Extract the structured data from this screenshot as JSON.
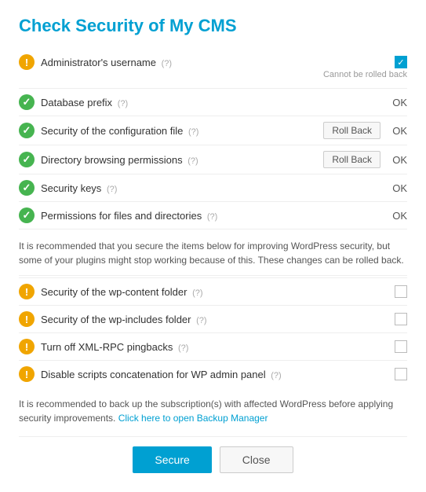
{
  "title": "Check Security of My CMS",
  "items_secure": [
    {
      "id": "admin-username",
      "label": "Administrator's username",
      "help": "(?)",
      "status": "",
      "has_checkbox": true,
      "checked": true,
      "cannot_rollback": "Cannot be rolled back",
      "icon": "warn",
      "has_rollback": false
    },
    {
      "id": "db-prefix",
      "label": "Database prefix",
      "help": "(?)",
      "status": "OK",
      "has_checkbox": false,
      "icon": "ok",
      "has_rollback": false
    },
    {
      "id": "config-file",
      "label": "Security of the configuration file",
      "help": "(?)",
      "status": "OK",
      "has_checkbox": false,
      "icon": "ok",
      "has_rollback": true,
      "rollback_label": "Roll Back"
    },
    {
      "id": "dir-browsing",
      "label": "Directory browsing permissions",
      "help": "(?)",
      "status": "OK",
      "has_checkbox": false,
      "icon": "ok",
      "has_rollback": true,
      "rollback_label": "Roll Back"
    },
    {
      "id": "security-keys",
      "label": "Security keys",
      "help": "(?)",
      "status": "OK",
      "has_checkbox": false,
      "icon": "ok",
      "has_rollback": false
    },
    {
      "id": "file-permissions",
      "label": "Permissions for files and directories",
      "help": "(?)",
      "status": "OK",
      "has_checkbox": false,
      "icon": "ok",
      "has_rollback": false
    }
  ],
  "info_text": "It is recommended that you secure the items below for improving WordPress security, but some of your plugins might stop working because of this. These changes can be rolled back.",
  "items_optional": [
    {
      "id": "wp-content",
      "label": "Security of the wp-content folder",
      "help": "(?)",
      "icon": "warn"
    },
    {
      "id": "wp-includes",
      "label": "Security of the wp-includes folder",
      "help": "(?)",
      "icon": "warn"
    },
    {
      "id": "xml-rpc",
      "label": "Turn off XML-RPC pingbacks",
      "help": "(?)",
      "icon": "warn"
    },
    {
      "id": "scripts-concat",
      "label": "Disable scripts concatenation for WP admin panel",
      "help": "(?)",
      "icon": "warn"
    }
  ],
  "bottom_text_prefix": "It is recommended to back up the subscription(s) with affected WordPress before applying security improvements. ",
  "bottom_link_label": "Click here to open Backup Manager",
  "buttons": {
    "secure": "Secure",
    "close": "Close"
  }
}
